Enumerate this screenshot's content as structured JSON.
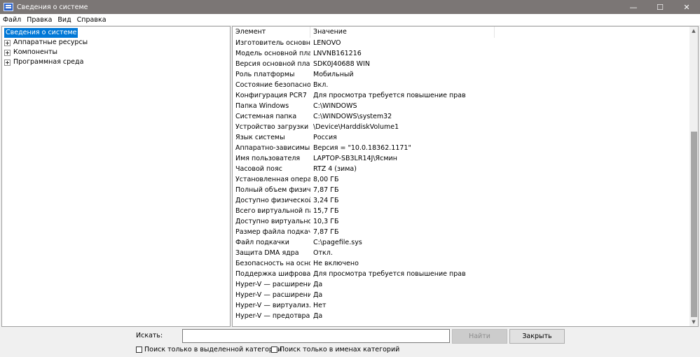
{
  "window": {
    "title": "Сведения о системе",
    "min": "—",
    "max": "☐",
    "close": "✕"
  },
  "menu": [
    "Файл",
    "Правка",
    "Вид",
    "Справка"
  ],
  "tree": {
    "root": "Сведения о системе",
    "children": [
      "Аппаратные ресурсы",
      "Компоненты",
      "Программная среда"
    ]
  },
  "columns": {
    "item": "Элемент",
    "value": "Значение"
  },
  "rows": [
    [
      "Изготовитель основно...",
      "LENOVO"
    ],
    [
      "Модель основной пла...",
      "LNVNB161216"
    ],
    [
      "Версия основной платы",
      "SDK0J40688 WIN"
    ],
    [
      "Роль платформы",
      "Мобильный"
    ],
    [
      "Состояние безопасно...",
      "Вкл."
    ],
    [
      "Конфигурация PCR7",
      "Для просмотра требуется повышение прав"
    ],
    [
      "Папка Windows",
      "C:\\WINDOWS"
    ],
    [
      "Системная папка",
      "C:\\WINDOWS\\system32"
    ],
    [
      "Устройство загрузки",
      "\\Device\\HarddiskVolume1"
    ],
    [
      "Язык системы",
      "Россия"
    ],
    [
      "Аппаратно-зависимы...",
      "Версия = \"10.0.18362.1171\""
    ],
    [
      "Имя пользователя",
      "LAPTOP-SB3LR14J\\Ясмин"
    ],
    [
      "Часовой пояс",
      "RTZ 4 (зима)"
    ],
    [
      "Установленная операт...",
      "8,00 ГБ"
    ],
    [
      "Полный объем физич...",
      "7,87 ГБ"
    ],
    [
      "Доступно физической ...",
      "3,24 ГБ"
    ],
    [
      "Всего виртуальной па...",
      "15,7 ГБ"
    ],
    [
      "Доступно виртуально...",
      "10,3 ГБ"
    ],
    [
      "Размер файла подкачки",
      "7,87 ГБ"
    ],
    [
      "Файл подкачки",
      "C:\\pagefile.sys"
    ],
    [
      "Защита DMA ядра",
      "Откл."
    ],
    [
      "Безопасность на осно...",
      "Не включено"
    ],
    [
      "Поддержка шифрован...",
      "Для просмотра требуется повышение прав"
    ],
    [
      "Hyper-V — расширени...",
      "Да"
    ],
    [
      "Hyper-V — расширени...",
      "Да"
    ],
    [
      "Hyper-V — виртуализ...",
      "Нет"
    ],
    [
      "Hyper-V — предотвра...",
      "Да"
    ]
  ],
  "search": {
    "label": "Искать:",
    "value": "",
    "find_label": "Найти",
    "close_label": "Закрыть",
    "option_selected_category": "Поиск только в выделенной категории",
    "option_category_names": "Поиск только в именах категорий"
  },
  "colors": {
    "titlebar": "#7b7675",
    "selection": "#0078d7"
  }
}
